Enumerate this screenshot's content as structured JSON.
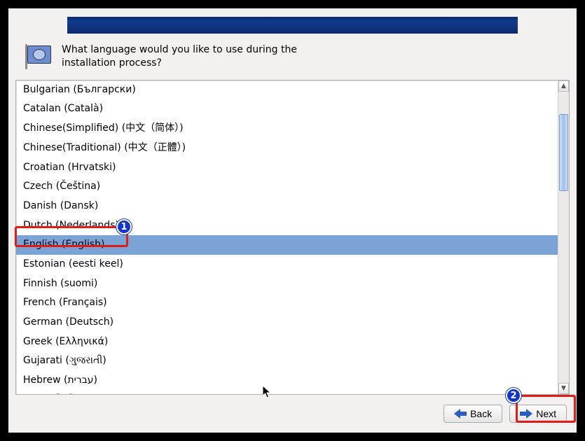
{
  "prompt": {
    "line1": "What language would you like to use during the",
    "line2": "installation process?"
  },
  "languages": [
    {
      "label": "Bulgarian (Български)",
      "selected": false
    },
    {
      "label": "Catalan (Català)",
      "selected": false
    },
    {
      "label": "Chinese(Simplified) (中文（简体）)",
      "selected": false
    },
    {
      "label": "Chinese(Traditional) (中文（正體）)",
      "selected": false
    },
    {
      "label": "Croatian (Hrvatski)",
      "selected": false
    },
    {
      "label": "Czech (Čeština)",
      "selected": false
    },
    {
      "label": "Danish (Dansk)",
      "selected": false
    },
    {
      "label": "Dutch (Nederlands)",
      "selected": false
    },
    {
      "label": "English (English)",
      "selected": true
    },
    {
      "label": "Estonian (eesti keel)",
      "selected": false
    },
    {
      "label": "Finnish (suomi)",
      "selected": false
    },
    {
      "label": "French (Français)",
      "selected": false
    },
    {
      "label": "German (Deutsch)",
      "selected": false
    },
    {
      "label": "Greek (Ελληνικά)",
      "selected": false
    },
    {
      "label": "Gujarati (ગુજરાતી)",
      "selected": false
    },
    {
      "label": "Hebrew (עברית)",
      "selected": false
    },
    {
      "label": "Hindi (हिन्दी)",
      "selected": false
    }
  ],
  "buttons": {
    "back": "Back",
    "next": "Next"
  },
  "annotations": {
    "marker1": "1",
    "marker2": "2"
  }
}
